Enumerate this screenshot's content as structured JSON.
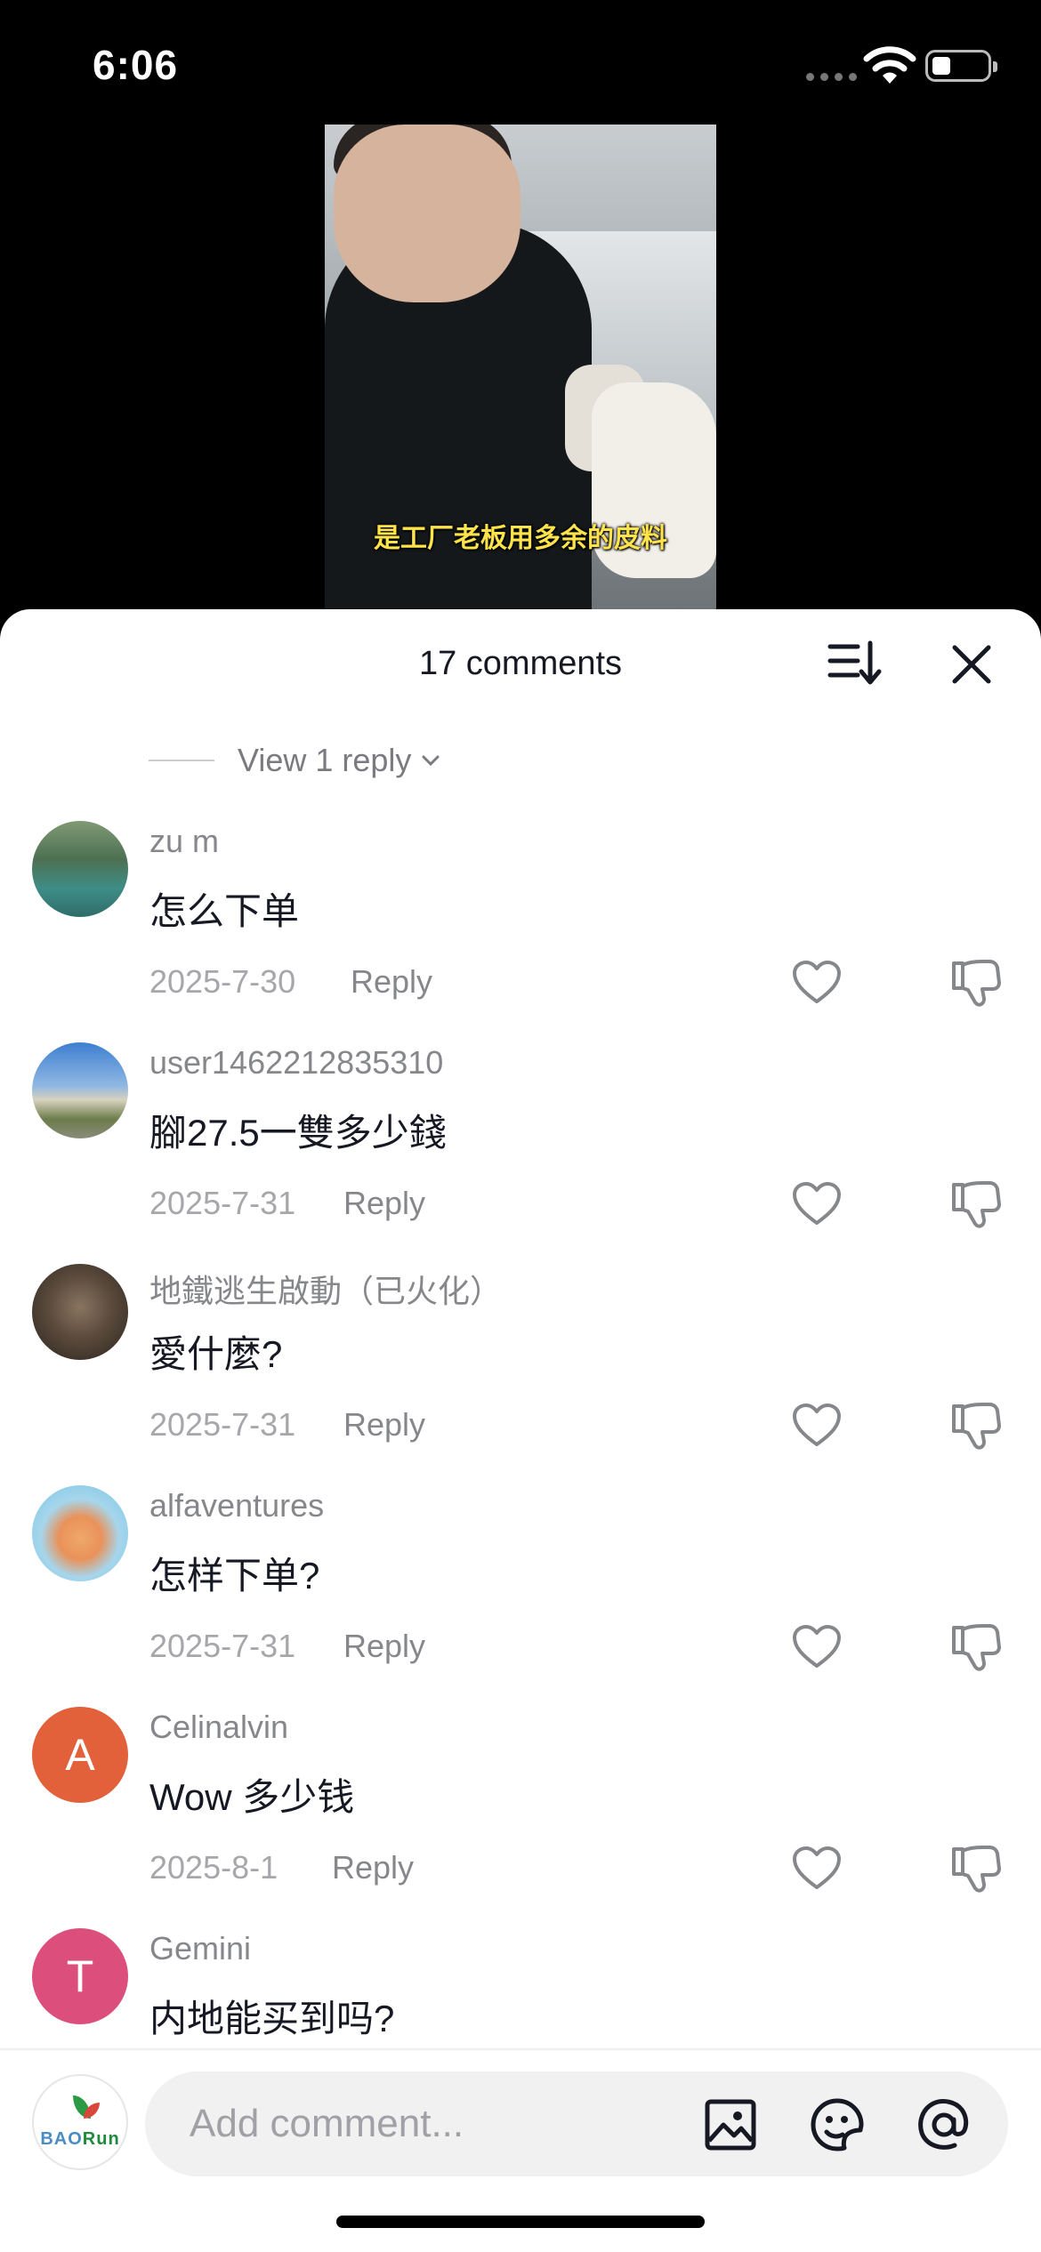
{
  "status_bar": {
    "time": "6:06"
  },
  "video": {
    "subtitle": "是工厂老板用多余的皮料"
  },
  "comments_sheet": {
    "title": "17 comments",
    "view_reply": "View 1 reply",
    "comments": [
      {
        "user": "zu m",
        "text": "怎么下单",
        "date": "2025-7-30",
        "reply": "Reply"
      },
      {
        "user": "user1462212835310",
        "text": "腳27.5一雙多少錢",
        "date": "2025-7-31",
        "reply": "Reply"
      },
      {
        "user": "地鐵逃生啟動（已火化）",
        "text": "愛什麼?",
        "date": "2025-7-31",
        "reply": "Reply"
      },
      {
        "user": "alfaventures",
        "text": "怎样下单?",
        "date": "2025-7-31",
        "reply": "Reply"
      },
      {
        "user": "Celinalvin",
        "text": "Wow 多少钱",
        "date": "2025-8-1",
        "reply": "Reply",
        "avatar_letter": "A",
        "avatar_color": "#e2603a"
      },
      {
        "user": "Gemini",
        "text": "内地能买到吗?",
        "avatar_letter": "T",
        "avatar_color": "#dc4f7d"
      }
    ]
  },
  "composer": {
    "placeholder": "Add comment...",
    "avatar_brand": {
      "prefix": "BAO",
      "suffix": "Run"
    }
  },
  "icons": [
    "sort-icon",
    "close-icon",
    "heart-icon",
    "dislike-icon",
    "image-icon",
    "sticker-icon",
    "mention-icon"
  ]
}
